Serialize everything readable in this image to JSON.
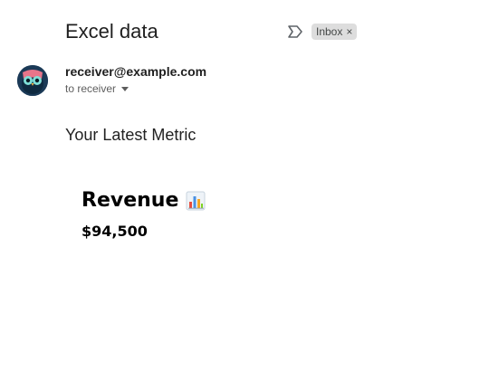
{
  "email": {
    "subject": "Excel data",
    "label": "Inbox",
    "label_close": "×",
    "sender": "receiver@example.com",
    "recipient": "to receiver"
  },
  "body": {
    "intro": "Your Latest Metric",
    "metric_title": "Revenue",
    "metric_value": "$94,500"
  },
  "icons": {
    "importance": "importance-marker-icon",
    "avatar": "owl-avatar",
    "metric": "bar-chart-emoji-icon",
    "recipient_details": "caret-down-icon"
  },
  "colors": {
    "chip_background": "#dddddd",
    "avatar_background": "#1b3a57",
    "text_primary": "#1f1f1f",
    "text_secondary": "#5e5e5e"
  }
}
